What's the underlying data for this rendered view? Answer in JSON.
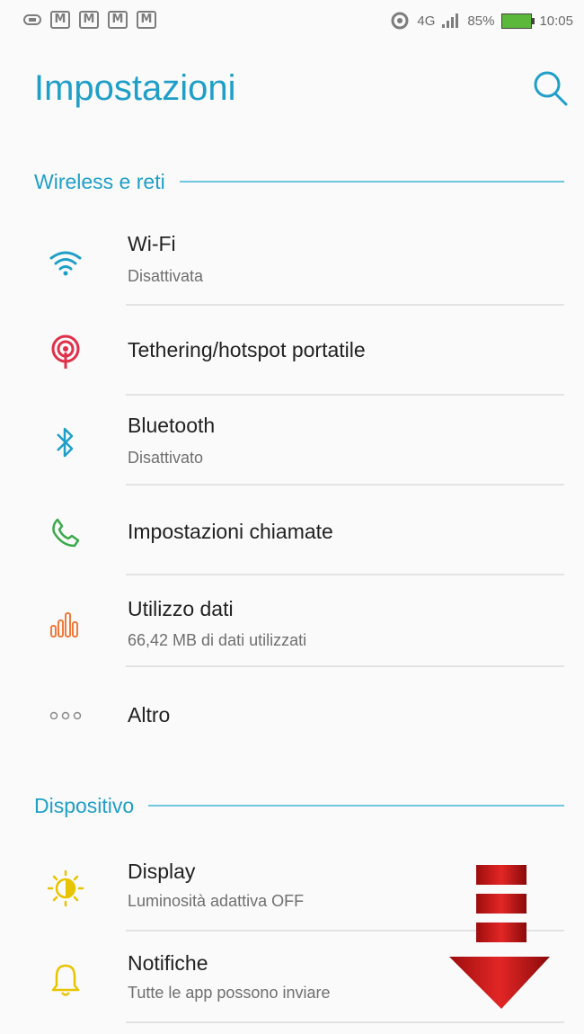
{
  "status_bar": {
    "notifications": [
      "M",
      "M",
      "M",
      "M"
    ],
    "network": "4G",
    "battery": "85%",
    "time": "10:05"
  },
  "header": {
    "title": "Impostazioni"
  },
  "sections": [
    {
      "title": "Wireless e reti",
      "items": [
        {
          "icon": "wifi-icon",
          "title": "Wi-Fi",
          "subtitle": "Disattivata"
        },
        {
          "icon": "hotspot-icon",
          "title": "Tethering/hotspot portatile",
          "subtitle": ""
        },
        {
          "icon": "bluetooth-icon",
          "title": "Bluetooth",
          "subtitle": "Disattivato"
        },
        {
          "icon": "phone-icon",
          "title": "Impostazioni chiamate",
          "subtitle": ""
        },
        {
          "icon": "data-usage-icon",
          "title": "Utilizzo dati",
          "subtitle": "66,42 MB di dati utilizzati"
        },
        {
          "icon": "more-icon",
          "title": "Altro",
          "subtitle": ""
        }
      ]
    },
    {
      "title": "Dispositivo",
      "items": [
        {
          "icon": "display-icon",
          "title": "Display",
          "subtitle": "Luminosità adattiva OFF"
        },
        {
          "icon": "bell-icon",
          "title": "Notifiche",
          "subtitle": "Tutte le app possono inviare"
        }
      ]
    }
  ],
  "colors": {
    "accent": "#1f9fc8",
    "wifi": "#1f9fc8",
    "hotspot": "#e0304a",
    "bluetooth": "#1f9fc8",
    "phone": "#3aa94a",
    "data_usage": "#f07a3a",
    "more": "#8a8a8a",
    "display": "#e8c400",
    "bell": "#e8c400",
    "arrow": "#d41b1b"
  }
}
